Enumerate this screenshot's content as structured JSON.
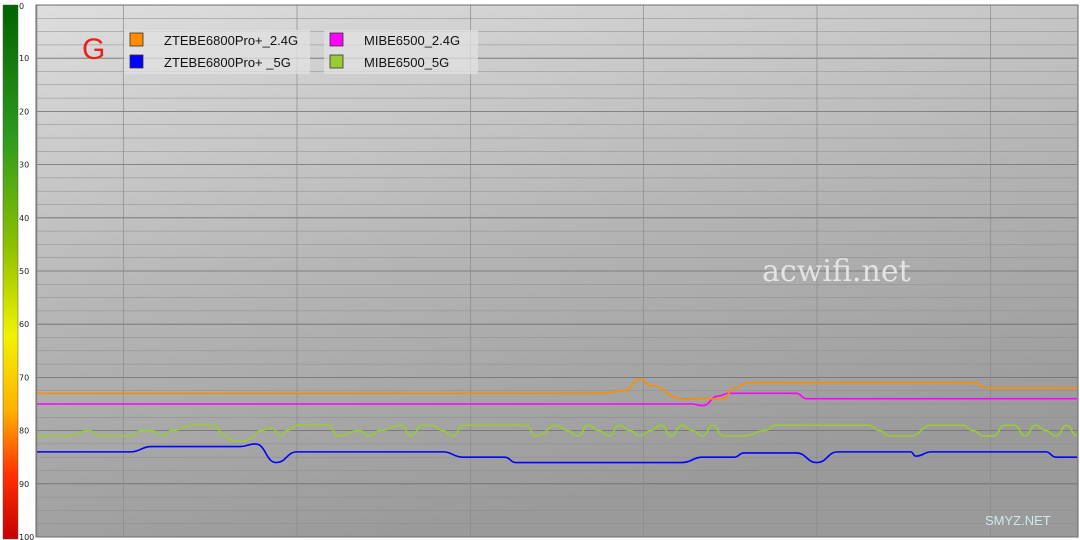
{
  "chart_data": {
    "type": "line",
    "title": "G",
    "y_ticks": [
      "0",
      "10",
      "20",
      "30",
      "40",
      "50",
      "60",
      "70",
      "80",
      "90",
      "100"
    ],
    "ylim": [
      0,
      100
    ],
    "y_inverted": true,
    "xlim": [
      0,
      100
    ],
    "grid": true,
    "legend_position": "top-left",
    "series": [
      {
        "name": "ZTEBE6800Pro+_2.4G",
        "color": "#ff8c00",
        "x": [
          0,
          54,
          56.5,
          58,
          59,
          62,
          66,
          67,
          68.5,
          90,
          91.5,
          100
        ],
        "y": [
          73,
          73,
          72.5,
          70.3,
          71.5,
          74,
          74,
          72,
          71,
          71,
          72,
          72
        ]
      },
      {
        "name": "ZTEBE6800Pro+ _5G",
        "color": "#0000ff",
        "x": [
          0,
          9,
          11,
          19.5,
          21,
          23,
          25,
          39,
          41,
          45,
          46,
          62,
          64,
          67,
          68,
          73,
          75,
          77,
          78,
          80,
          81,
          84,
          84.5,
          86,
          90,
          92,
          95,
          97,
          98,
          100
        ],
        "y": [
          84,
          84,
          83,
          83,
          82.5,
          86,
          84,
          84,
          85,
          85,
          86,
          86,
          85,
          85,
          84.2,
          84.2,
          86,
          84,
          84,
          84,
          84,
          84,
          84.8,
          84,
          84,
          84,
          84,
          84,
          85,
          85
        ]
      },
      {
        "name": "MIBE6500_2.4G",
        "color": "#ff00ff",
        "x": [
          0,
          63,
          64,
          65.5,
          66.5,
          73,
          74,
          75,
          100
        ],
        "y": [
          75,
          75,
          75.3,
          73.5,
          73,
          73,
          74,
          74,
          74
        ]
      },
      {
        "name": "MIBE6500_5G",
        "color": "#99cc33",
        "x": [
          0,
          3,
          5,
          6,
          7,
          9,
          10,
          11,
          12,
          13,
          15,
          16,
          17,
          18,
          19,
          20,
          20.5,
          21.5,
          22.5,
          23.5,
          24,
          25,
          26,
          28,
          29,
          31,
          32,
          33,
          35,
          36,
          37,
          38,
          39,
          40,
          41,
          43,
          44,
          45,
          46,
          47,
          48,
          50,
          51,
          52,
          53,
          54,
          55,
          56,
          57,
          58,
          59,
          60,
          61,
          62,
          63,
          64,
          65,
          66,
          67,
          68,
          70,
          71,
          72,
          73,
          74,
          75,
          76,
          77,
          78,
          79,
          80,
          81,
          82,
          83,
          84,
          86,
          87,
          88,
          89,
          90,
          91,
          92,
          93,
          94,
          95,
          96,
          97,
          98,
          99,
          100
        ],
        "y": [
          81,
          81,
          80,
          81,
          81,
          81,
          80,
          80,
          81,
          80,
          79,
          79,
          79,
          81,
          82,
          82,
          81.5,
          80,
          79.5,
          81,
          80,
          79,
          79,
          79,
          81,
          80,
          81,
          80,
          79,
          81,
          79,
          79,
          80,
          81,
          79,
          79,
          79,
          79,
          79,
          79,
          81,
          79,
          80,
          81,
          79,
          80,
          81,
          79,
          80,
          81,
          80,
          79,
          81,
          79,
          80,
          81,
          79,
          81,
          81,
          81,
          80,
          79,
          79,
          79,
          79,
          79,
          79,
          79,
          79,
          79,
          79,
          80,
          81,
          81,
          81,
          79,
          79,
          79,
          79,
          80,
          81,
          81,
          79,
          79,
          81,
          79,
          80,
          81,
          79,
          81
        ]
      }
    ],
    "watermarks": [
      "acwifi.net",
      "SMYZ.NET"
    ]
  }
}
